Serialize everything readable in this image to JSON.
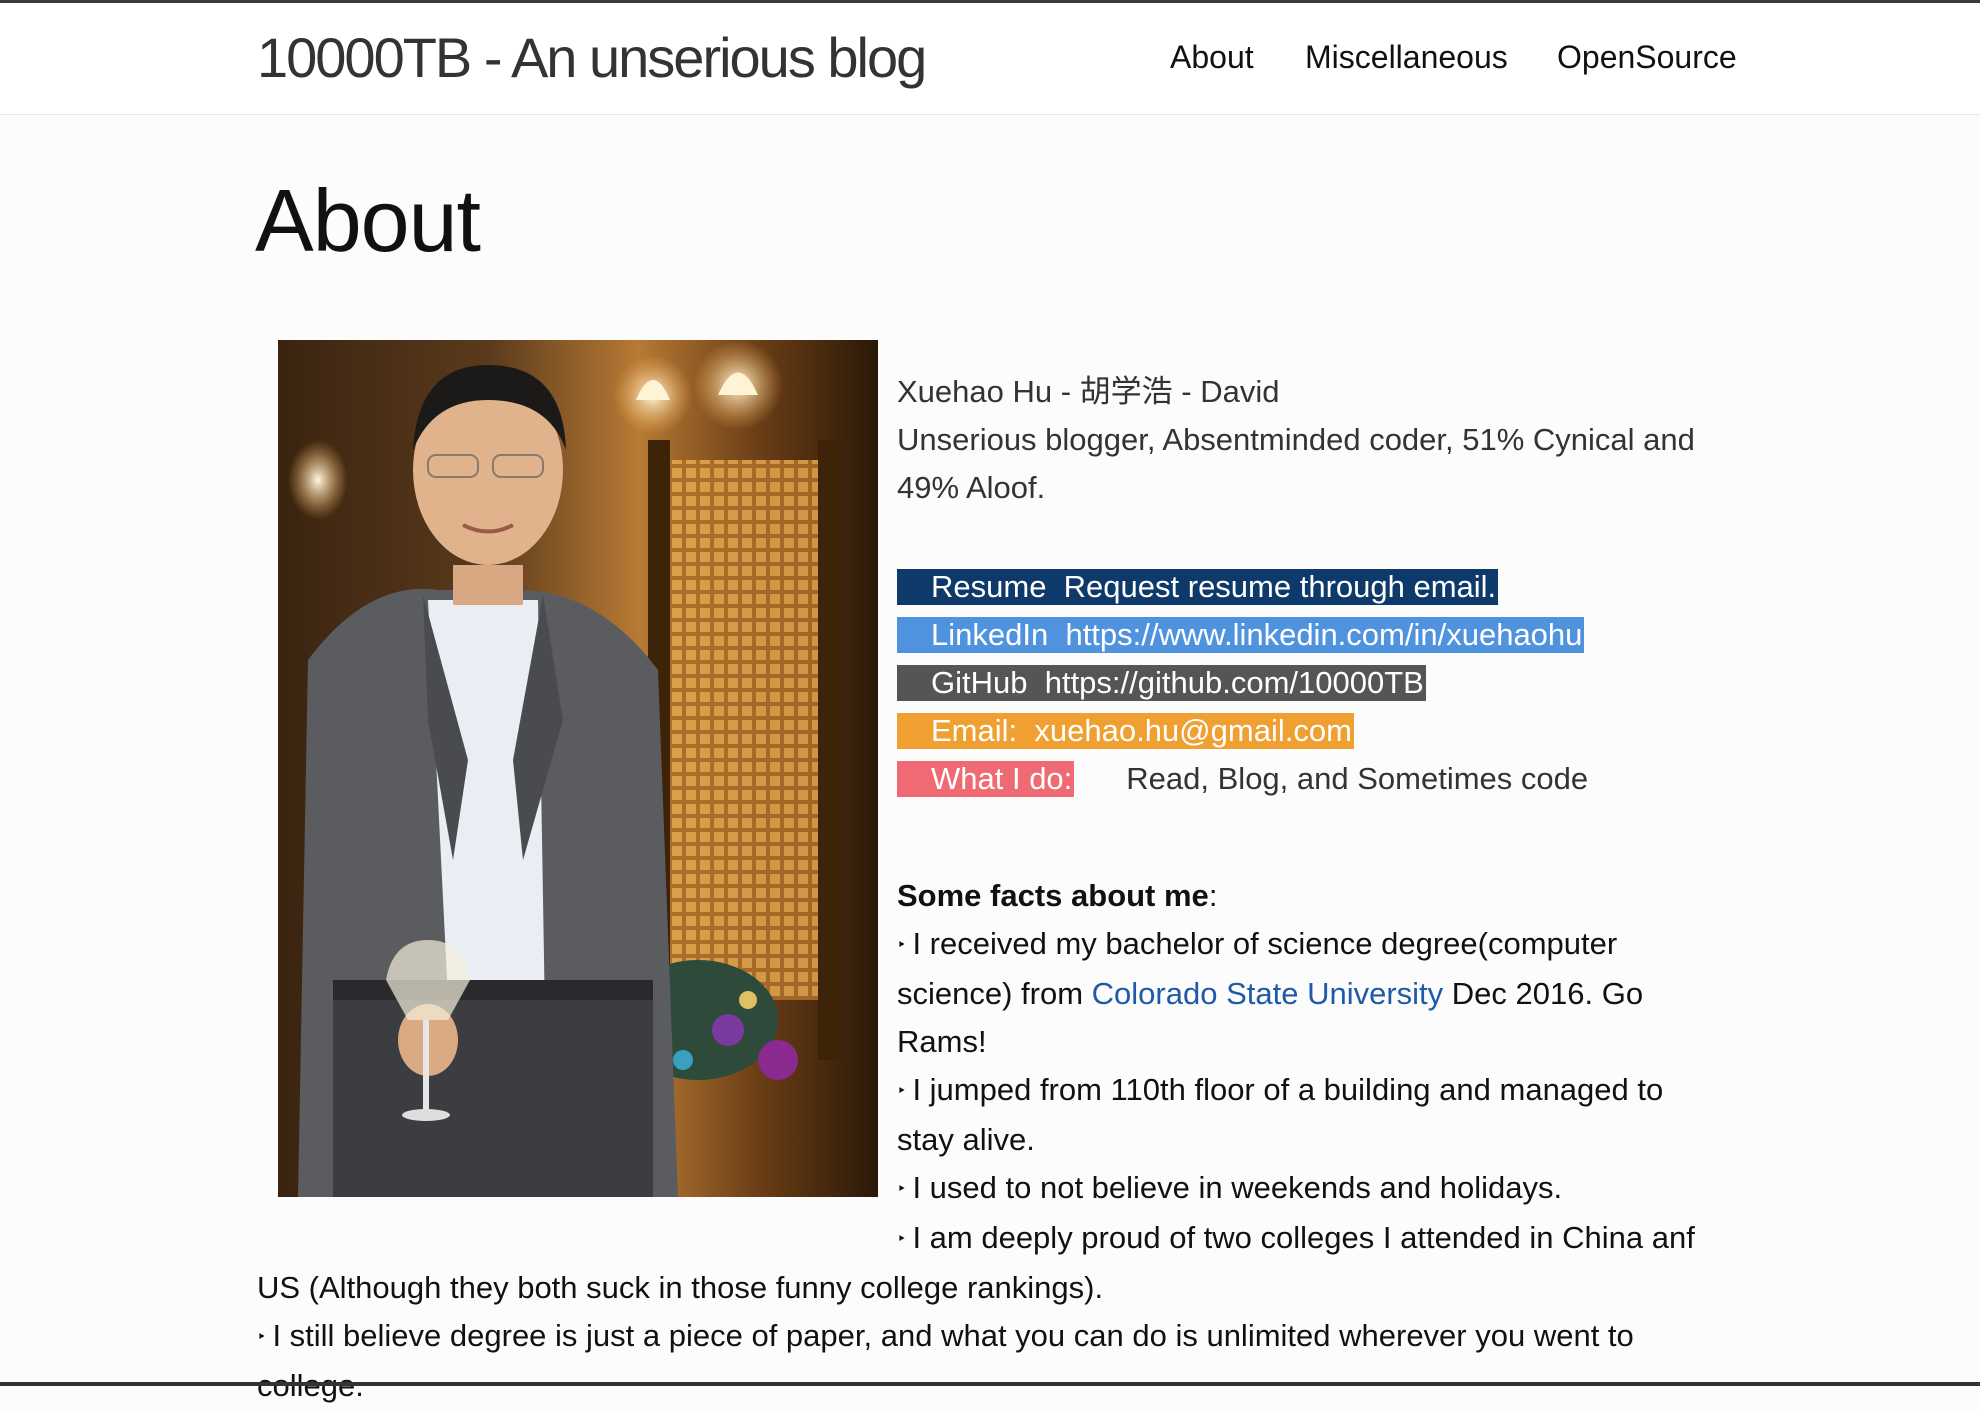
{
  "site": {
    "title": "10000TB - An unserious blog",
    "nav": [
      "About",
      "Miscellaneous",
      "OpenSource"
    ]
  },
  "page": {
    "title": "About"
  },
  "profile": {
    "name": "Xuehao Hu - 胡学浩 - David",
    "bio_line1": "Unserious blogger, Absentminded coder, 51% Cynical and",
    "bio_line2": "49% Aloof."
  },
  "links": {
    "resume_label": "Resume",
    "resume_value": "Request resume through email.",
    "linkedin_label": "LinkedIn",
    "linkedin_value": "https://www.linkedin.com/in/xuehaohu",
    "github_label": "GitHub",
    "github_value": "https://github.com/10000TB",
    "email_label": "Email:",
    "email_value": "xuehao.hu@gmail.com",
    "whatido_label": "What I do:",
    "whatido_value": "Read, Blog, and Sometimes code"
  },
  "facts": {
    "heading": "Some facts about me",
    "heading_colon": ":",
    "bullet": "‣",
    "f1_a": "I received my bachelor of science degree(computer",
    "f1_b_pre": "science) from ",
    "f1_b_link": "Colorado State University",
    "f1_b_post": " Dec 2016. Go",
    "f1_c": "Rams!",
    "f2_a": "I jumped from 110th floor of a building and managed to",
    "f2_b": "stay alive.",
    "f3": "I used to not believe in weekends and holidays.",
    "f4_a": "I am deeply proud of two colleges I attended in China anf",
    "f4_b": "US (Although they both suck in those funny college rankings).",
    "f5_a": "I still believe degree is just a piece of paper, and what you can do is unlimited wherever you went to",
    "f5_b": "college."
  },
  "colors": {
    "resume": "#0e3a6b",
    "linkedin": "#4f93df",
    "github": "#555555",
    "email": "#f0a030",
    "whatido": "#ef6a72",
    "link": "#1e5aa8"
  },
  "icons": {
    "bullet": "triangle-bullet-icon",
    "photo": "profile-photo"
  }
}
